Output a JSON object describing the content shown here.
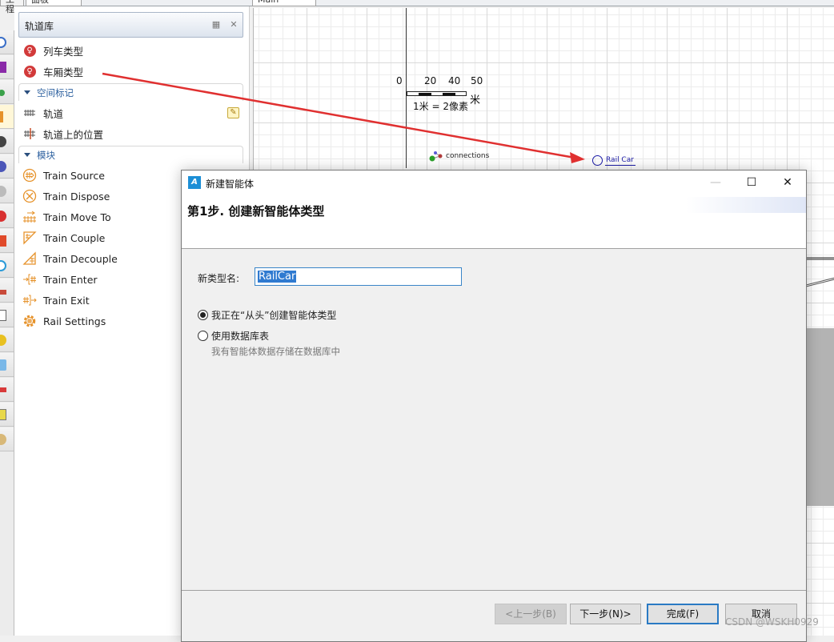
{
  "top_tabs": {
    "project": "工程",
    "palette": "面板",
    "main": "Main"
  },
  "palette": {
    "title": "轨道库",
    "header_icons": [
      "grid-view-icon",
      "close-icon"
    ],
    "agent_items": [
      {
        "label": "列车类型",
        "icon": "agent-type-icon"
      },
      {
        "label": "车厢类型",
        "icon": "agent-type-icon"
      }
    ],
    "sections": [
      {
        "label": "空间标记",
        "items": [
          {
            "label": "轨道",
            "icon": "track-icon",
            "editable": true
          },
          {
            "label": "轨道上的位置",
            "icon": "position-on-track-icon"
          }
        ]
      },
      {
        "label": "模块",
        "items": [
          {
            "label": "Train Source",
            "icon": "train-source-icon"
          },
          {
            "label": "Train Dispose",
            "icon": "train-dispose-icon"
          },
          {
            "label": "Train Move To",
            "icon": "train-move-to-icon"
          },
          {
            "label": "Train Couple",
            "icon": "train-couple-icon"
          },
          {
            "label": "Train Decouple",
            "icon": "train-decouple-icon"
          },
          {
            "label": "Train Enter",
            "icon": "train-enter-icon"
          },
          {
            "label": "Train Exit",
            "icon": "train-exit-icon"
          },
          {
            "label": "Rail Settings",
            "icon": "rail-settings-icon"
          }
        ]
      }
    ]
  },
  "canvas": {
    "scale": {
      "ticks": [
        "0",
        "20",
        "40",
        "50"
      ],
      "unit": "米",
      "ratio": "1米 = 2像素"
    },
    "connections_label": "connections",
    "railcar_label": "Rail Car"
  },
  "dialog": {
    "title": "新建智能体",
    "step_title": "第1步. 创建新智能体类型",
    "name_label": "新类型名:",
    "name_value": "RailCar",
    "options": [
      {
        "label": "我正在“从头”创建智能体类型",
        "selected": true
      },
      {
        "label": "使用数据库表",
        "selected": false,
        "description": "我有智能体数据存储在数据库中"
      }
    ],
    "buttons": {
      "back": "<上一步(B)",
      "next": "下一步(N)>",
      "finish": "完成(F)",
      "cancel": "取消"
    },
    "window_controls": {
      "minimize": "—",
      "maximize": "☐",
      "close": "✕"
    }
  },
  "watermark": "CSDN @WSKH0929",
  "colors": {
    "accent": "#2a7ac4",
    "annotation_arrow": "#e03030",
    "palette_section": "#2b5f9e",
    "module_icon": "#e6922a"
  }
}
